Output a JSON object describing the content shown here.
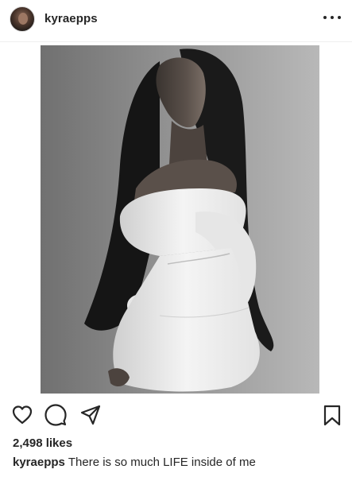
{
  "post": {
    "username": "kyraepps",
    "likes": "2,498 likes",
    "caption": {
      "username": "kyraepps",
      "text": "There is so much LIFE inside of me"
    }
  },
  "icons": {
    "more": "more-options-icon",
    "like": "heart-icon",
    "comment": "comment-icon",
    "share": "share-icon",
    "save": "bookmark-icon"
  },
  "colors": {
    "text": "#262626",
    "divider": "#efefef",
    "background": "#ffffff"
  }
}
